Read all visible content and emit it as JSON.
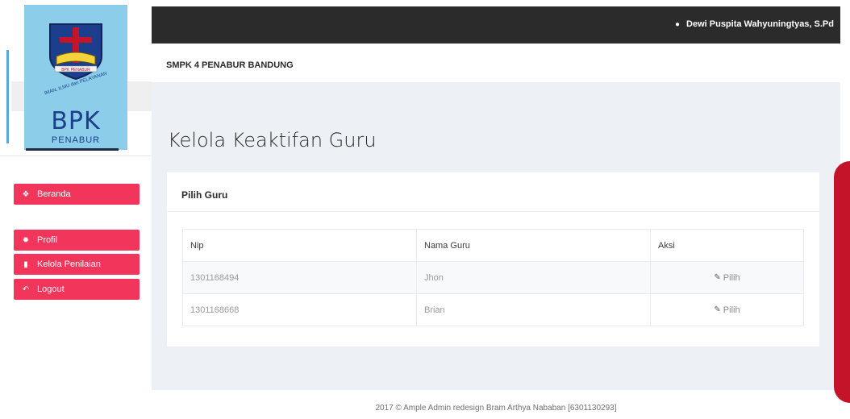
{
  "logo": {
    "brand": "BPK",
    "sub": "PENABUR",
    "ribbon": "BPK PENABUR",
    "motto": "IMAN, ILMU dan PELAYANAN"
  },
  "sidebar": {
    "items": [
      {
        "label": "Beranda",
        "icon": "home-icon"
      },
      {
        "label": "Profil",
        "icon": "gear-icon"
      },
      {
        "label": "Kelola Penilaian",
        "icon": "file-icon"
      },
      {
        "label": "Logout",
        "icon": "reply-icon"
      }
    ]
  },
  "topbar": {
    "user_name": "Dewi Puspita Wahyuningtyas, S.Pd",
    "user_icon": "user-icon"
  },
  "school": {
    "name": "SMPK 4 PENABUR BANDUNG"
  },
  "main": {
    "title": "Kelola Keaktifan Guru",
    "card_title": "Pilih Guru",
    "table": {
      "headers": [
        "Nip",
        "Nama Guru",
        "Aksi"
      ],
      "rows": [
        {
          "nip": "1301168494",
          "nama": "Jhon",
          "aksi": "Pilih"
        },
        {
          "nip": "1301168668",
          "nama": "Brian",
          "aksi": "Pilih"
        }
      ]
    }
  },
  "footer": {
    "text": "2017 © Ample Admin redesign Bram Arthya Nababan [6301130293]"
  },
  "colors": {
    "accent": "#f2355a",
    "topbar": "#2b2b2b",
    "content_bg": "#edf1f5"
  }
}
